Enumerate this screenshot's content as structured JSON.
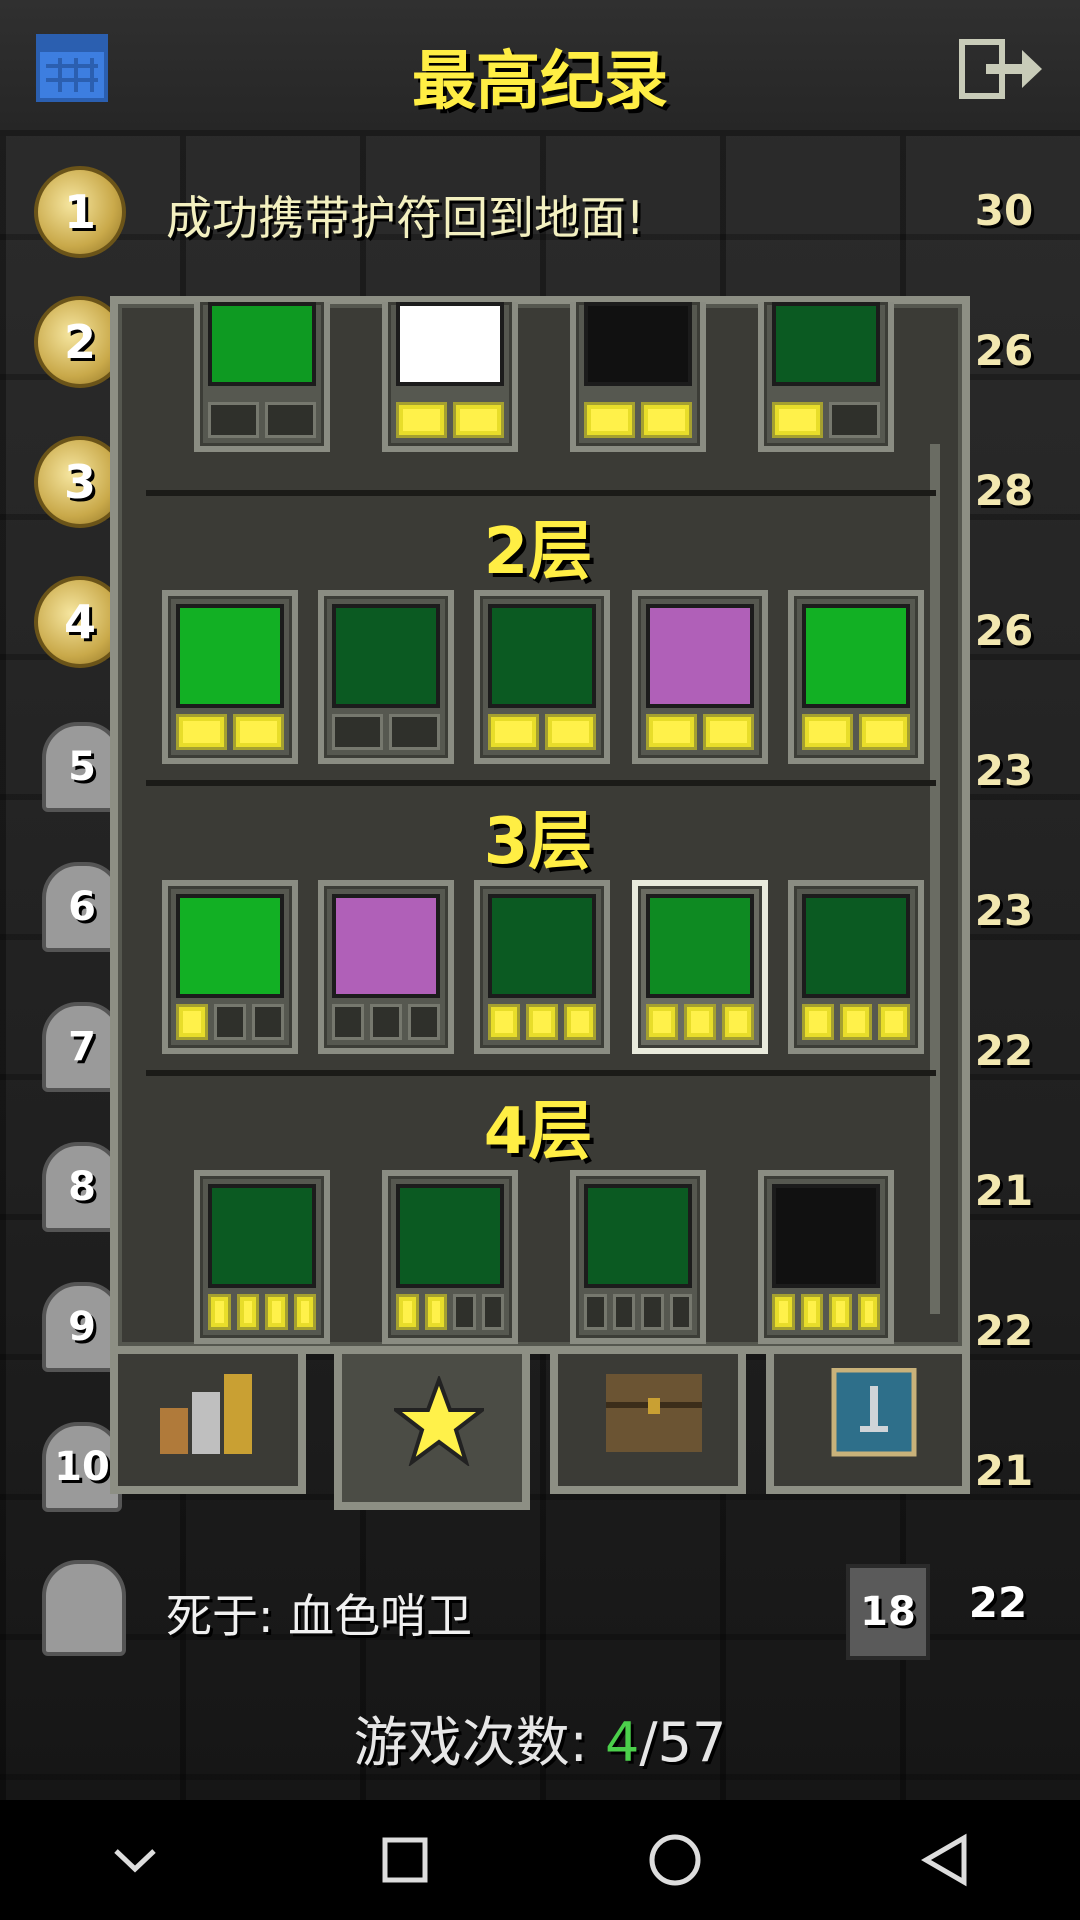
{
  "header": {
    "title": "最高纪录"
  },
  "records": [
    {
      "rank": "1",
      "text": "成功携带护符回到地面!",
      "depth": "30"
    },
    {
      "rank": "2",
      "depth": "26"
    },
    {
      "rank": "3",
      "depth": "28"
    },
    {
      "rank": "4",
      "depth": "26"
    },
    {
      "rank": "5",
      "depth": "23"
    },
    {
      "rank": "6",
      "depth": "23"
    },
    {
      "rank": "7",
      "depth": "22"
    },
    {
      "rank": "8",
      "depth": "21"
    },
    {
      "rank": "9",
      "depth": "22"
    },
    {
      "rank": "10",
      "depth": "21"
    }
  ],
  "badges_panel": {
    "tiers": [
      {
        "label": "2层"
      },
      {
        "label": "3层"
      },
      {
        "label": "4层"
      }
    ],
    "row0": [
      {
        "name": "food-badge",
        "pips": [
          0,
          0
        ]
      },
      {
        "name": "armor-badge",
        "pips": [
          1,
          1
        ]
      },
      {
        "name": "monster-badge",
        "pips": [
          1,
          1
        ]
      },
      {
        "name": "level-badge",
        "pips": [
          1,
          0
        ]
      }
    ],
    "row1": [
      {
        "name": "food-star-badge",
        "pips": [
          1,
          1
        ]
      },
      {
        "name": "potion-badge",
        "pips": [
          0,
          0
        ]
      },
      {
        "name": "tree-badge",
        "pips": [
          1,
          1
        ]
      },
      {
        "name": "magic-skull-badge",
        "pips": [
          1,
          1
        ]
      },
      {
        "name": "weapon-shield-badge",
        "pips": [
          1,
          1
        ]
      }
    ],
    "row2": [
      {
        "name": "weapon-arrow-badge",
        "pips": [
          1,
          0,
          0
        ]
      },
      {
        "name": "bow-badge",
        "pips": [
          0,
          0,
          0
        ]
      },
      {
        "name": "tree-weapon-badge",
        "pips": [
          1,
          1,
          1
        ]
      },
      {
        "name": "tree-shield-badge",
        "pips": [
          1,
          1,
          1
        ],
        "selected": true
      },
      {
        "name": "tree-target-badge",
        "pips": [
          1,
          1,
          1
        ]
      }
    ],
    "row3": [
      {
        "name": "bow-red-badge",
        "pips": [
          1,
          1,
          1,
          1
        ]
      },
      {
        "name": "bow-arrow-badge",
        "pips": [
          1,
          1,
          0,
          0
        ]
      },
      {
        "name": "bow-skull-badge",
        "pips": [
          0,
          0,
          0,
          0
        ]
      },
      {
        "name": "ghost-badge",
        "pips": [
          1,
          1,
          1,
          1
        ]
      }
    ]
  },
  "tabs": [
    "stats-tab",
    "badges-tab",
    "chest-tab",
    "journal-tab"
  ],
  "current_record": {
    "text": "死于: 血色哨卫",
    "floor": "18",
    "level": "22"
  },
  "games": {
    "label": "游戏次数:",
    "current": "4",
    "total": "/57"
  },
  "colors": {
    "accent": "#ffee44",
    "current_count": "#4bd04b"
  }
}
